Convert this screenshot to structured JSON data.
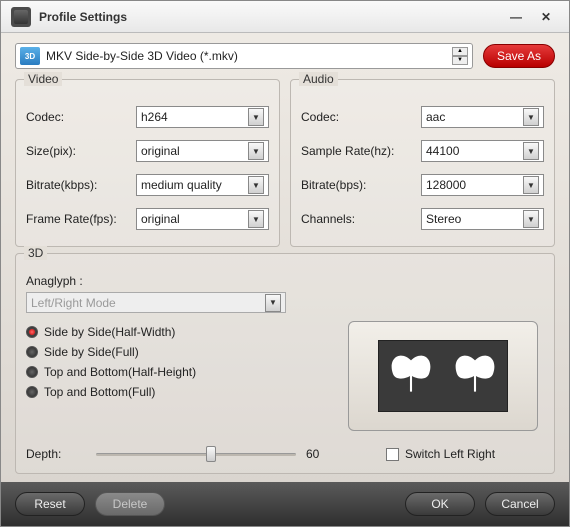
{
  "window": {
    "title": "Profile Settings"
  },
  "profile": {
    "icon_label": "3D",
    "selected": "MKV Side-by-Side 3D Video (*.mkv)",
    "save_as": "Save As"
  },
  "video": {
    "legend": "Video",
    "codec_label": "Codec:",
    "codec": "h264",
    "size_label": "Size(pix):",
    "size": "original",
    "bitrate_label": "Bitrate(kbps):",
    "bitrate": "medium quality",
    "framerate_label": "Frame Rate(fps):",
    "framerate": "original"
  },
  "audio": {
    "legend": "Audio",
    "codec_label": "Codec:",
    "codec": "aac",
    "samplerate_label": "Sample Rate(hz):",
    "samplerate": "44100",
    "bitrate_label": "Bitrate(bps):",
    "bitrate": "128000",
    "channels_label": "Channels:",
    "channels": "Stereo"
  },
  "three_d": {
    "legend": "3D",
    "anaglyph_label": "Anaglyph :",
    "anaglyph_mode": "Left/Right Mode",
    "options": [
      "Side by Side(Half-Width)",
      "Side by Side(Full)",
      "Top and Bottom(Half-Height)",
      "Top and Bottom(Full)"
    ],
    "selected_index": 0,
    "depth_label": "Depth:",
    "depth_value": "60",
    "switch_label": "Switch Left Right",
    "switch_checked": false
  },
  "footer": {
    "reset": "Reset",
    "delete": "Delete",
    "ok": "OK",
    "cancel": "Cancel"
  }
}
